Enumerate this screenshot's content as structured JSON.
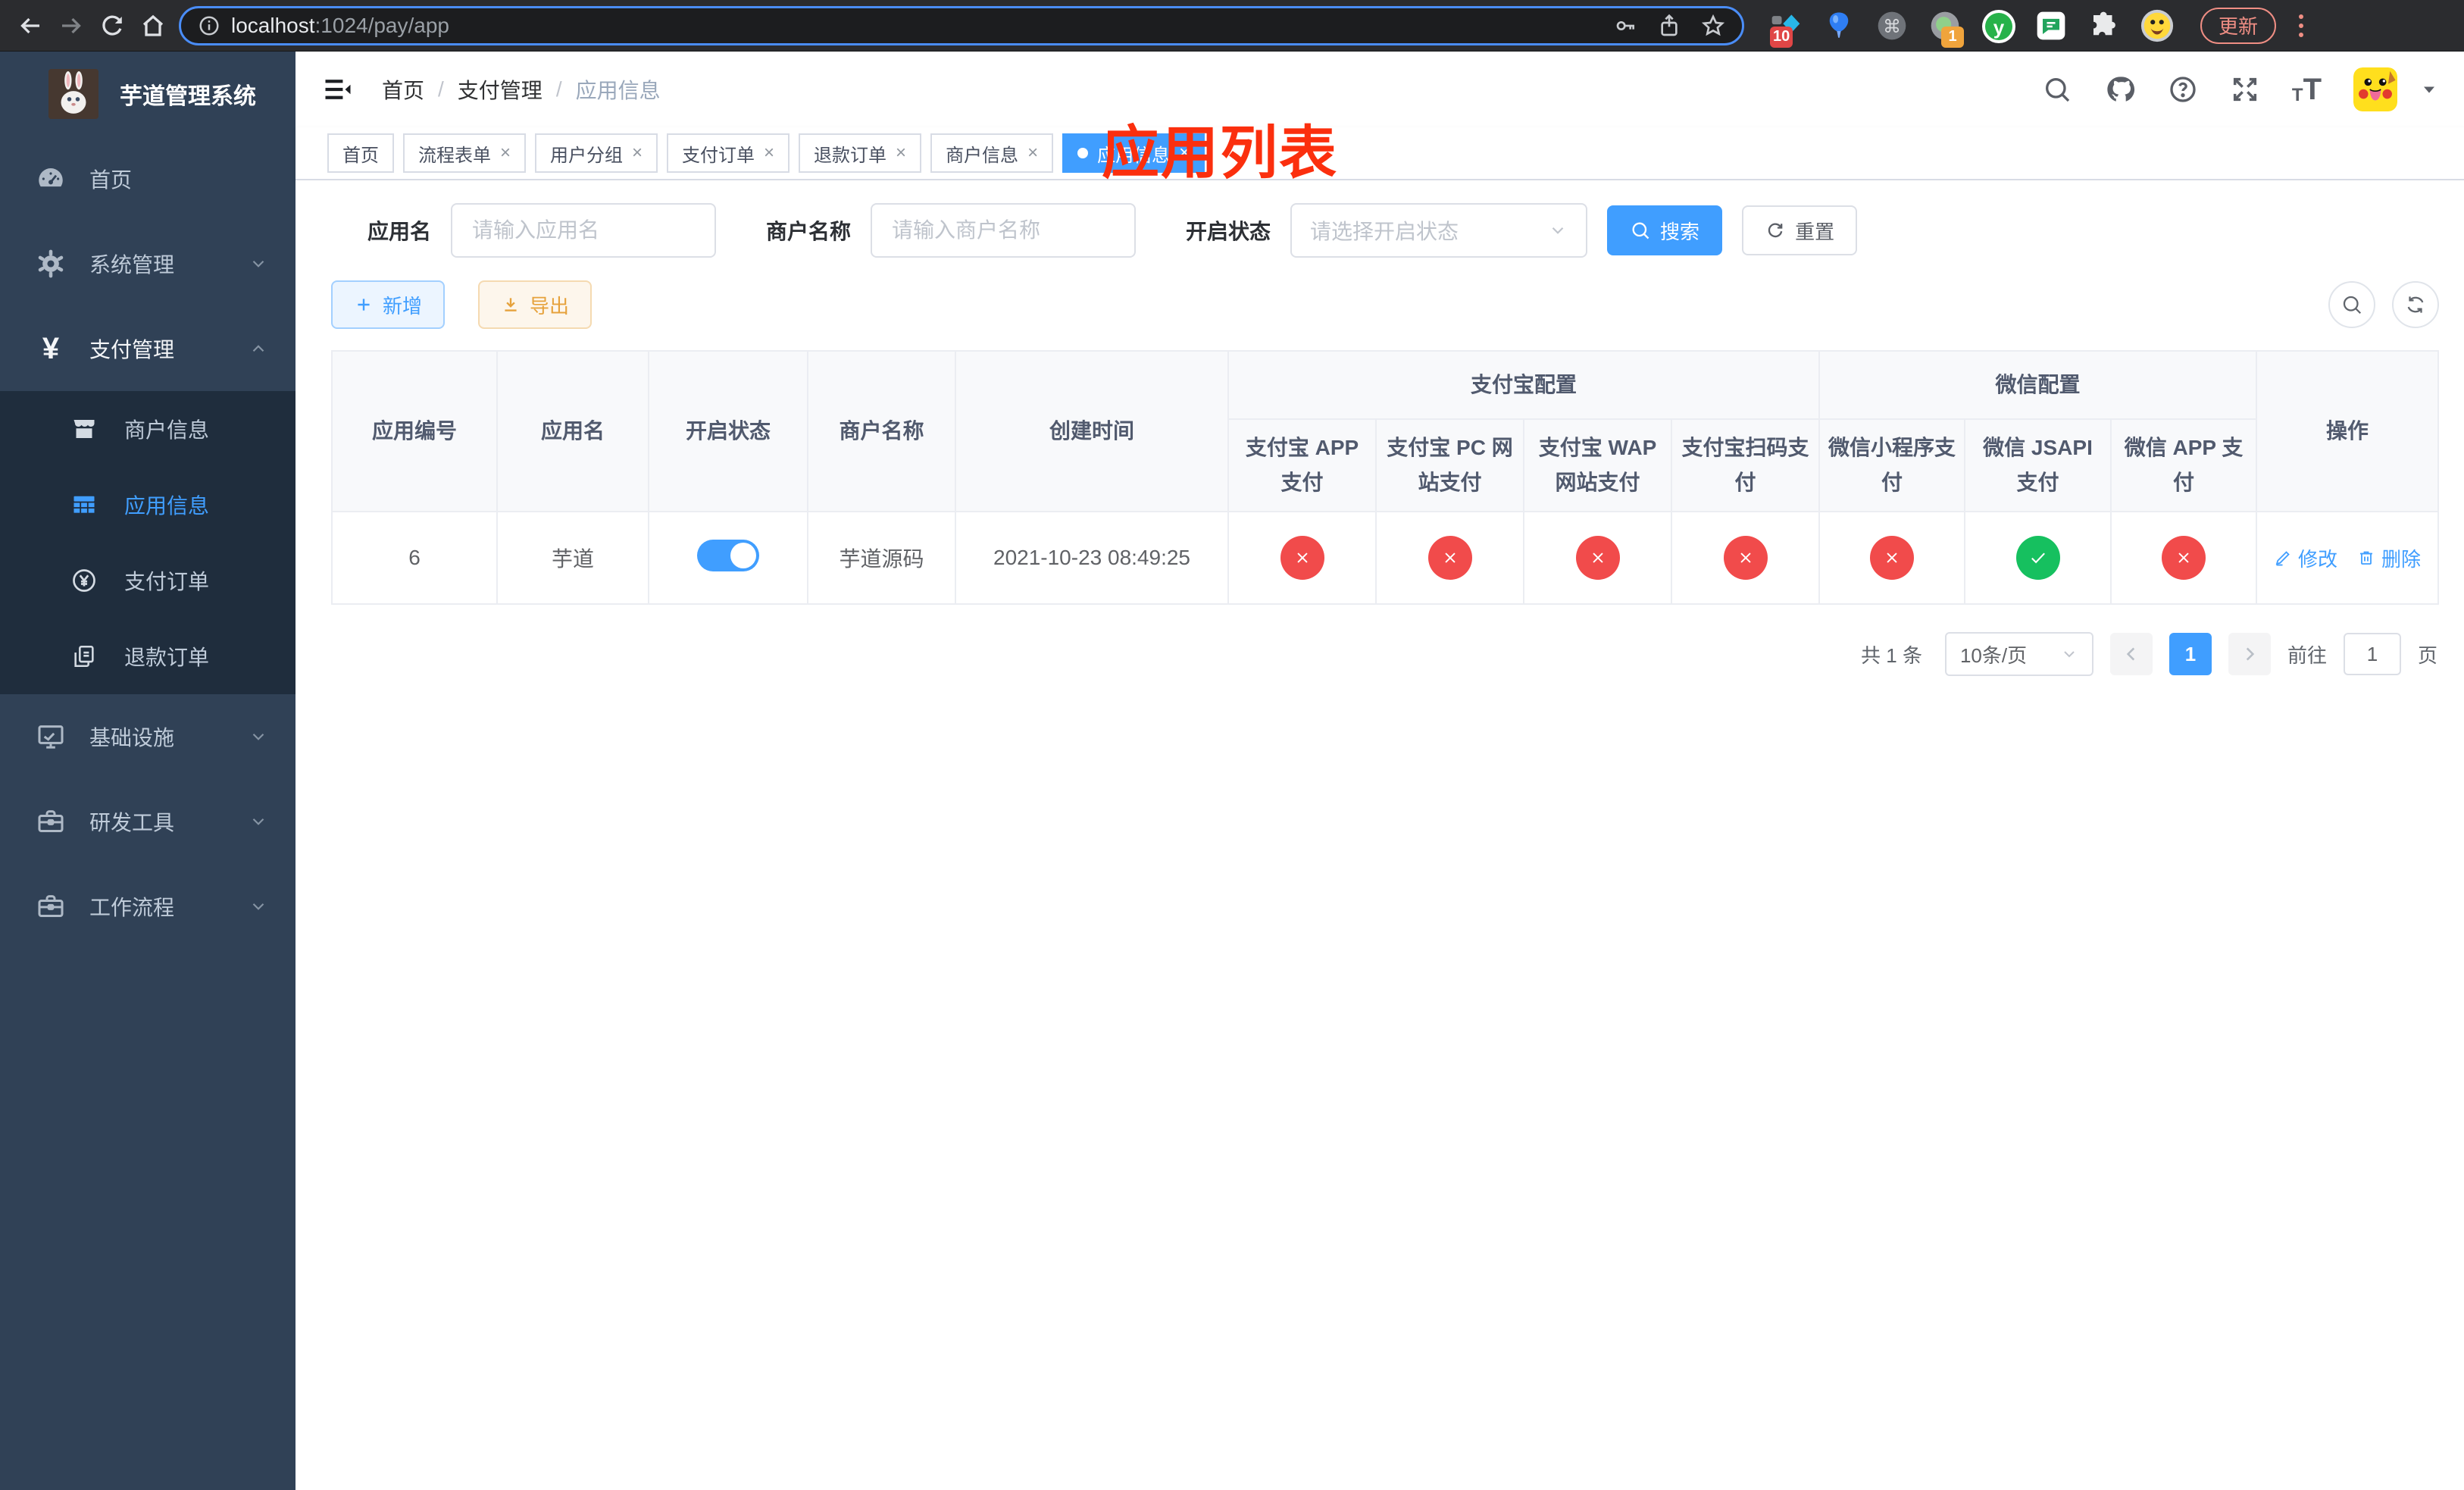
{
  "ui": {
    "close_glyph": "×",
    "slash": "/",
    "command_glyph": "⌘"
  },
  "browser": {
    "url_host": "localhost",
    "url_path": ":1024/pay/app",
    "update_label": "更新",
    "ext_badge_blue": "10",
    "ext_badge_rec": "1",
    "ext_y_letter": "y"
  },
  "annotation": {
    "text": "应用列表"
  },
  "sidebar": {
    "title": "芋道管理系统",
    "items": [
      {
        "label": "首页"
      },
      {
        "label": "系统管理"
      },
      {
        "label": "支付管理"
      },
      {
        "label": "基础设施"
      },
      {
        "label": "研发工具"
      },
      {
        "label": "工作流程"
      }
    ],
    "submenu": [
      {
        "label": "商户信息"
      },
      {
        "label": "应用信息"
      },
      {
        "label": "支付订单"
      },
      {
        "label": "退款订单"
      }
    ]
  },
  "breadcrumb": {
    "items": [
      "首页",
      "支付管理",
      "应用信息"
    ]
  },
  "tabs": [
    {
      "label": "首页"
    },
    {
      "label": "流程表单"
    },
    {
      "label": "用户分组"
    },
    {
      "label": "支付订单"
    },
    {
      "label": "退款订单"
    },
    {
      "label": "商户信息"
    },
    {
      "label": "应用信息"
    }
  ],
  "filters": {
    "app_name_label": "应用名",
    "app_name_placeholder": "请输入应用名",
    "merchant_label": "商户名称",
    "merchant_placeholder": "请输入商户名称",
    "status_label": "开启状态",
    "status_placeholder": "请选择开启状态",
    "search_label": "搜索",
    "reset_label": "重置"
  },
  "toolbar": {
    "add_label": "新增",
    "export_label": "导出"
  },
  "table": {
    "col_app_no": "应用编号",
    "col_app_name": "应用名",
    "col_status": "开启状态",
    "col_merchant": "商户名称",
    "col_created": "创建时间",
    "group_alipay": "支付宝配置",
    "group_wechat": "微信配置",
    "sub_headers": [
      "支付宝 APP 支付",
      "支付宝 PC 网站支付",
      "支付宝 WAP 网站支付",
      "支付宝扫码支付",
      "微信小程序支付",
      "微信 JSAPI 支付",
      "微信 APP 支付"
    ],
    "col_actions": "操作",
    "rows": [
      {
        "app_no": "6",
        "app_name": "芋道",
        "enabled": true,
        "merchant": "芋道源码",
        "created": "2021-10-23 08:49:25",
        "channels": [
          false,
          false,
          false,
          false,
          false,
          true,
          false
        ],
        "edit_label": "修改",
        "delete_label": "删除"
      }
    ]
  },
  "pagination": {
    "total": "共 1 条",
    "page_size": "10条/页",
    "current_page": "1",
    "goto_label": "前往",
    "goto_value": "1",
    "page_unit": "页"
  },
  "colors": {
    "primary": "#409eff",
    "sidebar_bg": "#304156",
    "submenu_bg": "#1f2d3d",
    "danger": "#f14b4b",
    "success": "#16c05f",
    "warning": "#e6a23c",
    "annotation_red": "#fb2f0e"
  }
}
